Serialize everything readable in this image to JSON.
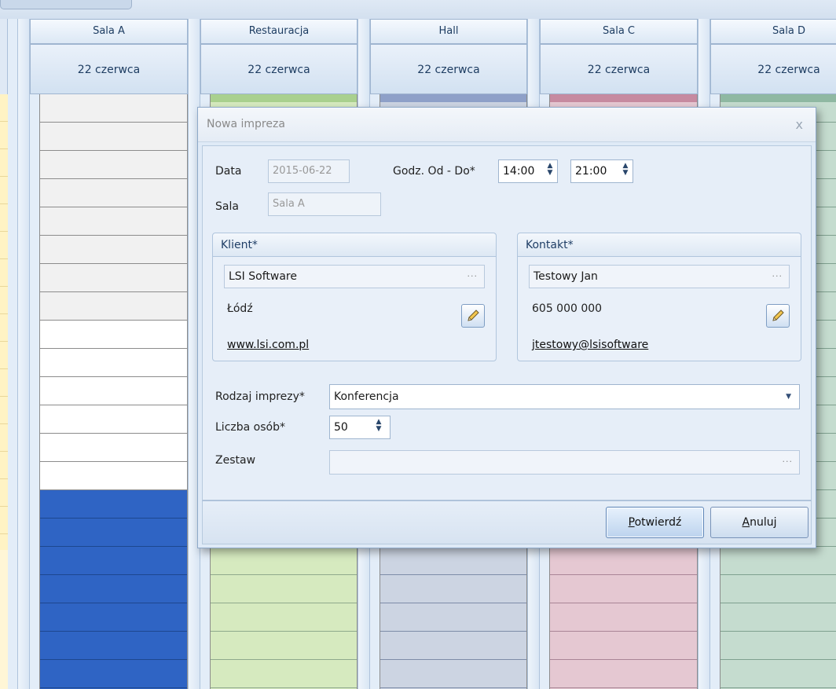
{
  "scheduler": {
    "columns": [
      {
        "room": "Sala A",
        "date": "22 czerwca"
      },
      {
        "room": "Restauracja",
        "date": "22 czerwca"
      },
      {
        "room": "Hall",
        "date": "22 czerwca"
      },
      {
        "room": "Sala C",
        "date": "22 czerwca"
      },
      {
        "room": "Sala D",
        "date": "22 czerwca"
      }
    ],
    "colors": {
      "sala_a_busy": "#2f64c4",
      "restauracja": "#a9d08e",
      "hall": "#8ea0c8",
      "sala_c": "#c68aa0",
      "sala_d": "#8fb8a2"
    }
  },
  "dialog": {
    "title": "Nowa impreza",
    "close_glyph": "x",
    "date_label": "Data",
    "date_value": "2015-06-22",
    "time_label": "Godz. Od - Do*",
    "time_from": "14:00",
    "time_to": "21:00",
    "room_label": "Sala",
    "room_value": "Sala A",
    "client": {
      "header": "Klient*",
      "name": "LSI Software",
      "city": "Łódź",
      "website": "www.lsi.com.pl"
    },
    "contact": {
      "header": "Kontakt*",
      "name": "Testowy Jan",
      "phone": "605 000 000",
      "email": "jtestowy@lsisoftware"
    },
    "event_type_label": "Rodzaj imprezy*",
    "event_type_value": "Konferencja",
    "people_label": "Liczba osób*",
    "people_value": "50",
    "set_label": "Zestaw",
    "set_value": "",
    "dots": "···",
    "confirm_underlined": "P",
    "confirm_rest": "otwierdź",
    "cancel_underlined": "A",
    "cancel_rest": "nuluj"
  },
  "icons": [
    "spin-up-icon",
    "spin-down-icon",
    "ellipsis-icon",
    "pencil-icon",
    "dropdown-arrow-icon",
    "close-icon"
  ]
}
